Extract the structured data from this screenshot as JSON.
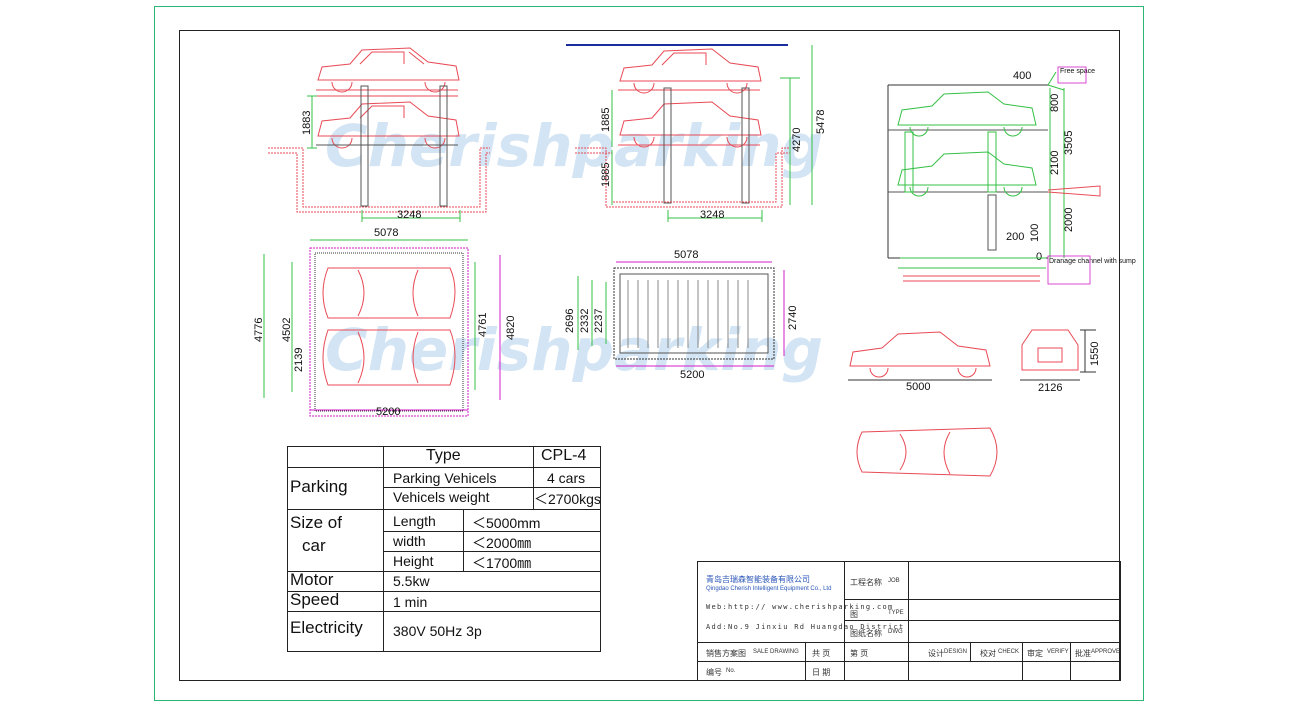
{
  "watermark": "Cherishparking",
  "dims": {
    "d1883": "1883",
    "d3248a": "3248",
    "d1885a": "1885",
    "d1885b": "1885",
    "d4270": "4270",
    "d5478": "5478",
    "d3248b": "3248",
    "d400": "400",
    "free_space": "Free space",
    "d800": "800",
    "d3505": "3505",
    "d2100": "2100",
    "d2000": "2000",
    "d200": "200",
    "d100": "100",
    "d0": "0",
    "drainage": "Dranage channel with sump",
    "d5078a": "5078",
    "d4776": "4776",
    "d4502": "4502",
    "d2139": "2139",
    "d4761": "4761",
    "d4820": "4820",
    "d5200a": "5200",
    "d5078b": "5078",
    "d2696": "2696",
    "d2332": "2332",
    "d2237": "2237",
    "d2740": "2740",
    "d5200b": "5200",
    "car_len": "5000",
    "car_w": "2126",
    "car_h": "1550"
  },
  "spec": {
    "type_label": "Type",
    "type_value": "CPL-4",
    "parking_label": "Parking",
    "parking_vehicles_label": "Parking Vehicels",
    "parking_vehicles_value": "4 cars",
    "vehicles_weight_label": "Vehicels weight",
    "vehicles_weight_value": "＜2700kgs",
    "size_label_1": "Size  of",
    "size_label_2": "car",
    "length_label": "Length",
    "length_value": "＜5000mm",
    "width_label": "width",
    "width_value": "＜2000㎜",
    "height_label": "Height",
    "height_value": "＜1700㎜",
    "motor_label": "Motor",
    "motor_value": "5.5kw",
    "speed_label": "Speed",
    "speed_value": "1 min",
    "electricity_label": "Electricity",
    "electricity_value": "380V  50Hz  3p"
  },
  "titleblock": {
    "company_cn": "青岛吉瑞森智能装备有限公司",
    "company_en": "Qingdao Cherish Intelligent Equipment Co., Ltd",
    "web": "Web:http:// www.cherishparking.com",
    "address": "Add:No.9 Jinxiu Rd Huangdao District",
    "project_cn": "工程名称",
    "project_en": "JOB",
    "type_cn": "图",
    "type_en": "TYPE",
    "drawing_cn": "图纸名称",
    "drawing_en": "DWG",
    "sale_cn": "销售方案图",
    "sale_en": "SALE DRAWING",
    "total_pages": "共    页",
    "page": "第    页",
    "design_cn": "设计",
    "design_en": "DESIGN",
    "check_cn": "校对",
    "check_en": "CHECK",
    "verify_cn": "审定",
    "verify_en": "VERIFY",
    "approve_cn": "批准",
    "approve_en": "APPROVE",
    "number_cn": "编号",
    "number_en": "No.",
    "date_cn": "日    期"
  }
}
